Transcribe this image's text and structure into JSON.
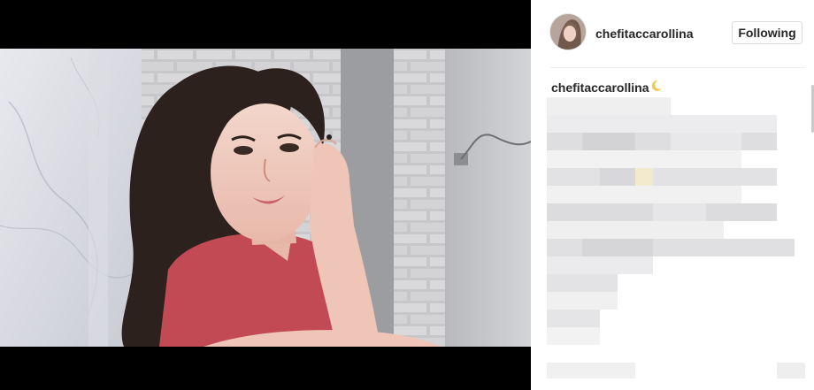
{
  "post": {
    "username": "chefitaccarollina",
    "follow_button_label": "Following",
    "caption_username": "chefitaccarollina",
    "caption_emoji_icon": "crescent-moon-icon",
    "caption_text_state": "pixelated"
  },
  "colors": {
    "text": "#262626",
    "border": "#dbdbdb",
    "shirt": "#c24a55"
  }
}
